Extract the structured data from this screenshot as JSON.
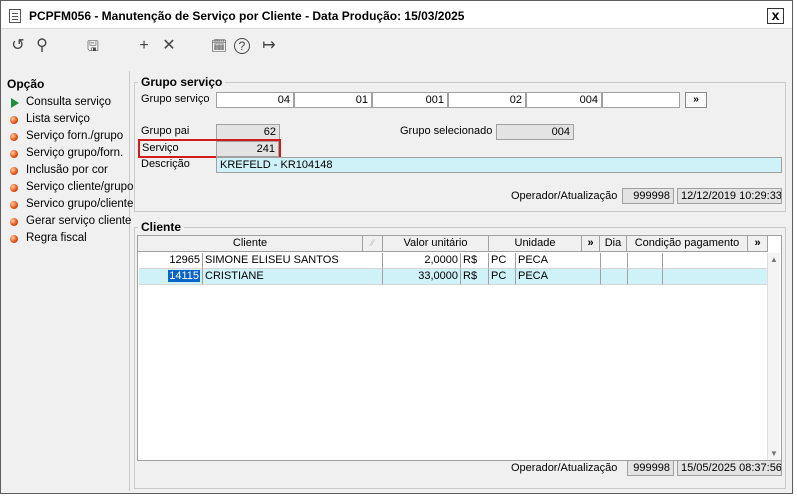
{
  "window": {
    "title": "PCPFM056 - Manutenção de Serviço por Cliente - Data Produção: 15/03/2025",
    "close": "x"
  },
  "toolbar": [
    "↺",
    "⚲",
    "🖫",
    "+",
    "✕",
    "🗓",
    "?",
    "↦"
  ],
  "sidebar": {
    "title": "Opção",
    "items": [
      {
        "label": "Consulta serviço",
        "icon": "arrow"
      },
      {
        "label": "Lista serviço",
        "icon": "bullet"
      },
      {
        "label": "Serviço forn./grupo",
        "icon": "bullet"
      },
      {
        "label": "Serviço grupo/forn.",
        "icon": "bullet"
      },
      {
        "label": "Inclusão por cor",
        "icon": "bullet"
      },
      {
        "label": "Serviço cliente/grupo",
        "icon": "bullet"
      },
      {
        "label": "Servico grupo/cliente",
        "icon": "bullet"
      },
      {
        "label": "Gerar serviço cliente",
        "icon": "bullet"
      },
      {
        "label": "Regra fiscal",
        "icon": "bullet"
      }
    ]
  },
  "grupo": {
    "legend": "Grupo serviço",
    "label": "Grupo serviço",
    "codes": [
      "04",
      "01",
      "001",
      "02",
      "004",
      ""
    ],
    "more": "»",
    "grupo_pai_label": "Grupo pai",
    "grupo_pai": "62",
    "grupo_sel_label": "Grupo selecionado",
    "grupo_sel": "004",
    "servico_label": "Serviço",
    "servico": "241",
    "descricao_label": "Descrição",
    "descricao": "KREFELD - KR104148",
    "operador_label": "Operador/Atualização",
    "operador": "999998",
    "data": "12/12/2019 10:29:33"
  },
  "cliente": {
    "legend": "Cliente",
    "headers": {
      "cliente": "Cliente",
      "valor": "Valor unitário",
      "unidade": "Unidade",
      "more1": "»",
      "dia": "Dia",
      "cond": "Condição pagamento",
      "more2": "»"
    },
    "rows": [
      {
        "code": "12965",
        "name": "SIMONE ELISEU SANTOS",
        "valor": "2,0000",
        "moeda": "R$",
        "un": "PC",
        "un_desc": "PECA"
      },
      {
        "code": "14115",
        "name": "CRISTIANE",
        "valor": "33,0000",
        "moeda": "R$",
        "un": "PC",
        "un_desc": "PECA"
      }
    ],
    "operador_label": "Operador/Atualização",
    "operador": "999998",
    "data": "15/05/2025 08:37:56"
  }
}
